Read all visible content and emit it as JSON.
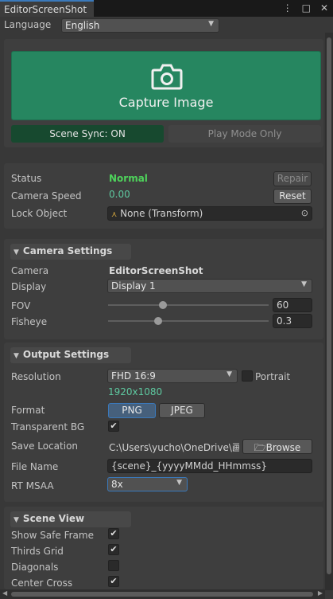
{
  "window": {
    "tab_title": "EditorScreenShot"
  },
  "language": {
    "label": "Language",
    "value": "English"
  },
  "capture": {
    "label": "Capture Image",
    "icon": "camera-icon"
  },
  "sync": {
    "scene_sync": "Scene Sync: ON",
    "play_mode": "Play Mode Only"
  },
  "status": {
    "status_label": "Status",
    "status_value": "Normal",
    "repair_label": "Repair",
    "speed_label": "Camera Speed",
    "speed_value": "0.00",
    "reset_label": "Reset",
    "lock_label": "Lock Object",
    "lock_value": "None (Transform)"
  },
  "camera_settings": {
    "header": "Camera Settings",
    "camera_label": "Camera",
    "camera_value": "EditorScreenShot",
    "display_label": "Display",
    "display_value": "Display 1",
    "fov_label": "FOV",
    "fov_value": "60",
    "fisheye_label": "Fisheye",
    "fisheye_value": "0.3"
  },
  "output_settings": {
    "header": "Output Settings",
    "resolution_label": "Resolution",
    "resolution_value": "FHD 16:9",
    "portrait_label": "Portrait",
    "resolution_size": "1920x1080",
    "format_label": "Format",
    "format_png": "PNG",
    "format_jpeg": "JPEG",
    "transparent_label": "Transparent BG",
    "save_label": "Save Location",
    "save_value": "C:\\Users\\yucho\\OneDrive\\画",
    "browse_label": "Browse",
    "filename_label": "File Name",
    "filename_value": "{scene}_{yyyyMMdd_HHmmss}",
    "msaa_label": "RT MSAA",
    "msaa_value": "8x"
  },
  "scene_view": {
    "header": "Scene View",
    "safe_frame_label": "Show Safe Frame",
    "thirds_label": "Thirds Grid",
    "diagonals_label": "Diagonals",
    "center_label": "Center Cross"
  },
  "colors": {
    "accent": "#268660",
    "sync_on": "#17492f",
    "status_ok": "#4ed35b",
    "value_mint": "#5ec9a0",
    "selection": "#3a79bb"
  }
}
